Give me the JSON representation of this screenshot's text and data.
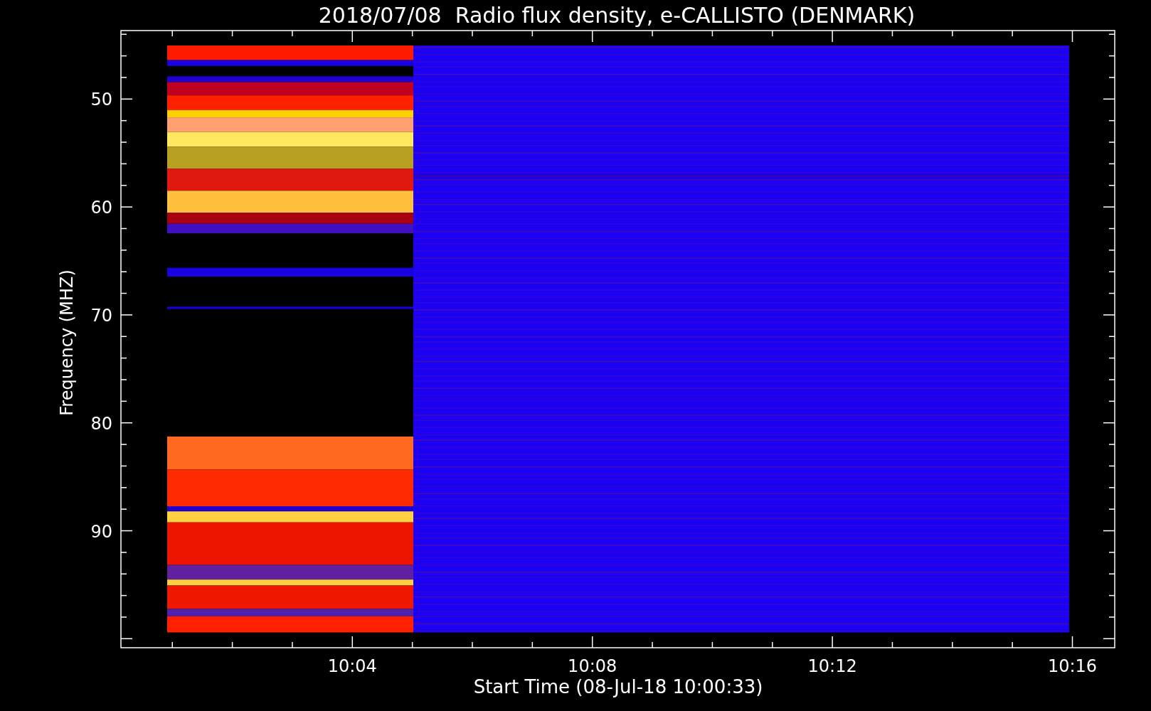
{
  "title": "2018/07/08  Radio flux density, e-CALLISTO (DENMARK)",
  "y_axis": {
    "title": "Frequency (MHZ)",
    "tick_labels": [
      "50",
      "60",
      "70",
      "80",
      "90"
    ]
  },
  "x_axis": {
    "title": "Start Time (08-Jul-18 10:00:33)",
    "tick_labels": [
      "10:04",
      "10:08",
      "10:12",
      "10:16"
    ]
  }
}
